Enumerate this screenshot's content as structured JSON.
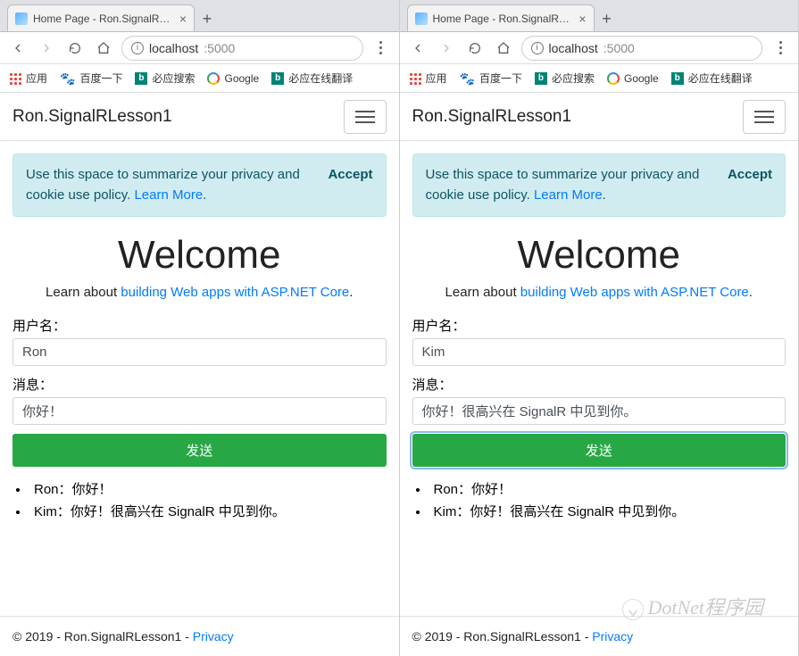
{
  "windows": [
    {
      "tab_title": "Home Page - Ron.SignalRLess",
      "url_host": "localhost",
      "url_port": ":5000",
      "brand": "Ron.SignalRLesson1",
      "alert_text_1": "Use this space to summarize your privacy and cookie use policy. ",
      "alert_link": "Learn More",
      "alert_text_2": ".",
      "alert_accept": "Accept",
      "welcome": "Welcome",
      "learn_text": "Learn about ",
      "learn_link": "building Web apps with ASP.NET Core",
      "learn_text_2": ".",
      "label_user": "用户名：",
      "input_user": "Ron",
      "label_msg": "消息：",
      "input_msg": "你好！",
      "send_label": "发送",
      "send_focused": false,
      "messages": [
        "Ron：你好！",
        "Kim：你好！很高兴在 SignalR 中见到你。"
      ],
      "footer_text": "© 2019 - Ron.SignalRLesson1 - ",
      "footer_link": "Privacy"
    },
    {
      "tab_title": "Home Page - Ron.SignalRLess",
      "url_host": "localhost",
      "url_port": ":5000",
      "brand": "Ron.SignalRLesson1",
      "alert_text_1": "Use this space to summarize your privacy and cookie use policy. ",
      "alert_link": "Learn More",
      "alert_text_2": ".",
      "alert_accept": "Accept",
      "welcome": "Welcome",
      "learn_text": "Learn about ",
      "learn_link": "building Web apps with ASP.NET Core",
      "learn_text_2": ".",
      "label_user": "用户名：",
      "input_user": "Kim",
      "label_msg": "消息：",
      "input_msg": "你好！很高兴在 SignalR 中见到你。",
      "send_label": "发送",
      "send_focused": true,
      "messages": [
        "Ron：你好！",
        "Kim：你好！很高兴在 SignalR 中见到你。"
      ],
      "footer_text": "© 2019 - Ron.SignalRLesson1 - ",
      "footer_link": "Privacy"
    }
  ],
  "bookmarks": [
    {
      "label": "应用",
      "icon": "apps"
    },
    {
      "label": "百度一下",
      "icon": "paw"
    },
    {
      "label": "必应搜索",
      "icon": "bing"
    },
    {
      "label": "Google",
      "icon": "g"
    },
    {
      "label": "必应在线翻译",
      "icon": "bing"
    }
  ],
  "watermark": "DotNet程序园"
}
